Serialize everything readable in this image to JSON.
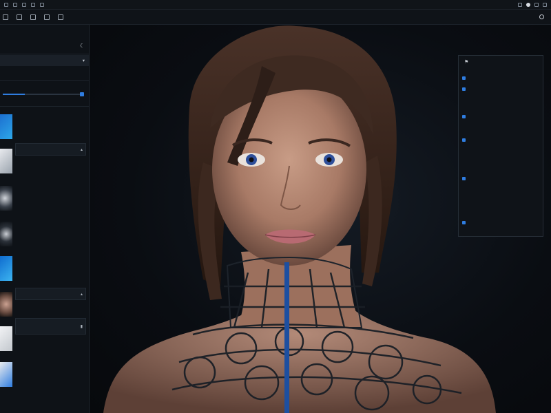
{
  "window": {
    "title": ""
  },
  "toolbar": {
    "center_items": [
      "",
      "",
      ""
    ]
  },
  "left_panel": {
    "header": "",
    "rows": [
      "",
      "",
      ""
    ],
    "section_label": "",
    "items": [
      {
        "title": "",
        "sub": ""
      },
      {
        "title": "",
        "sub": ""
      },
      {
        "title": "",
        "sub": ""
      },
      {
        "title": "",
        "sub": ""
      },
      {
        "title": "",
        "sub": ""
      },
      {
        "title": "",
        "sub": ""
      },
      {
        "title": "",
        "sub": ""
      },
      {
        "title": "",
        "sub": ""
      }
    ]
  },
  "right_panel": {
    "header": "",
    "lines": [
      "",
      "",
      "",
      "",
      "",
      ""
    ]
  },
  "colors": {
    "accent": "#2f7de0",
    "panel": "#0f1318",
    "canvas": "#0a0d12"
  }
}
